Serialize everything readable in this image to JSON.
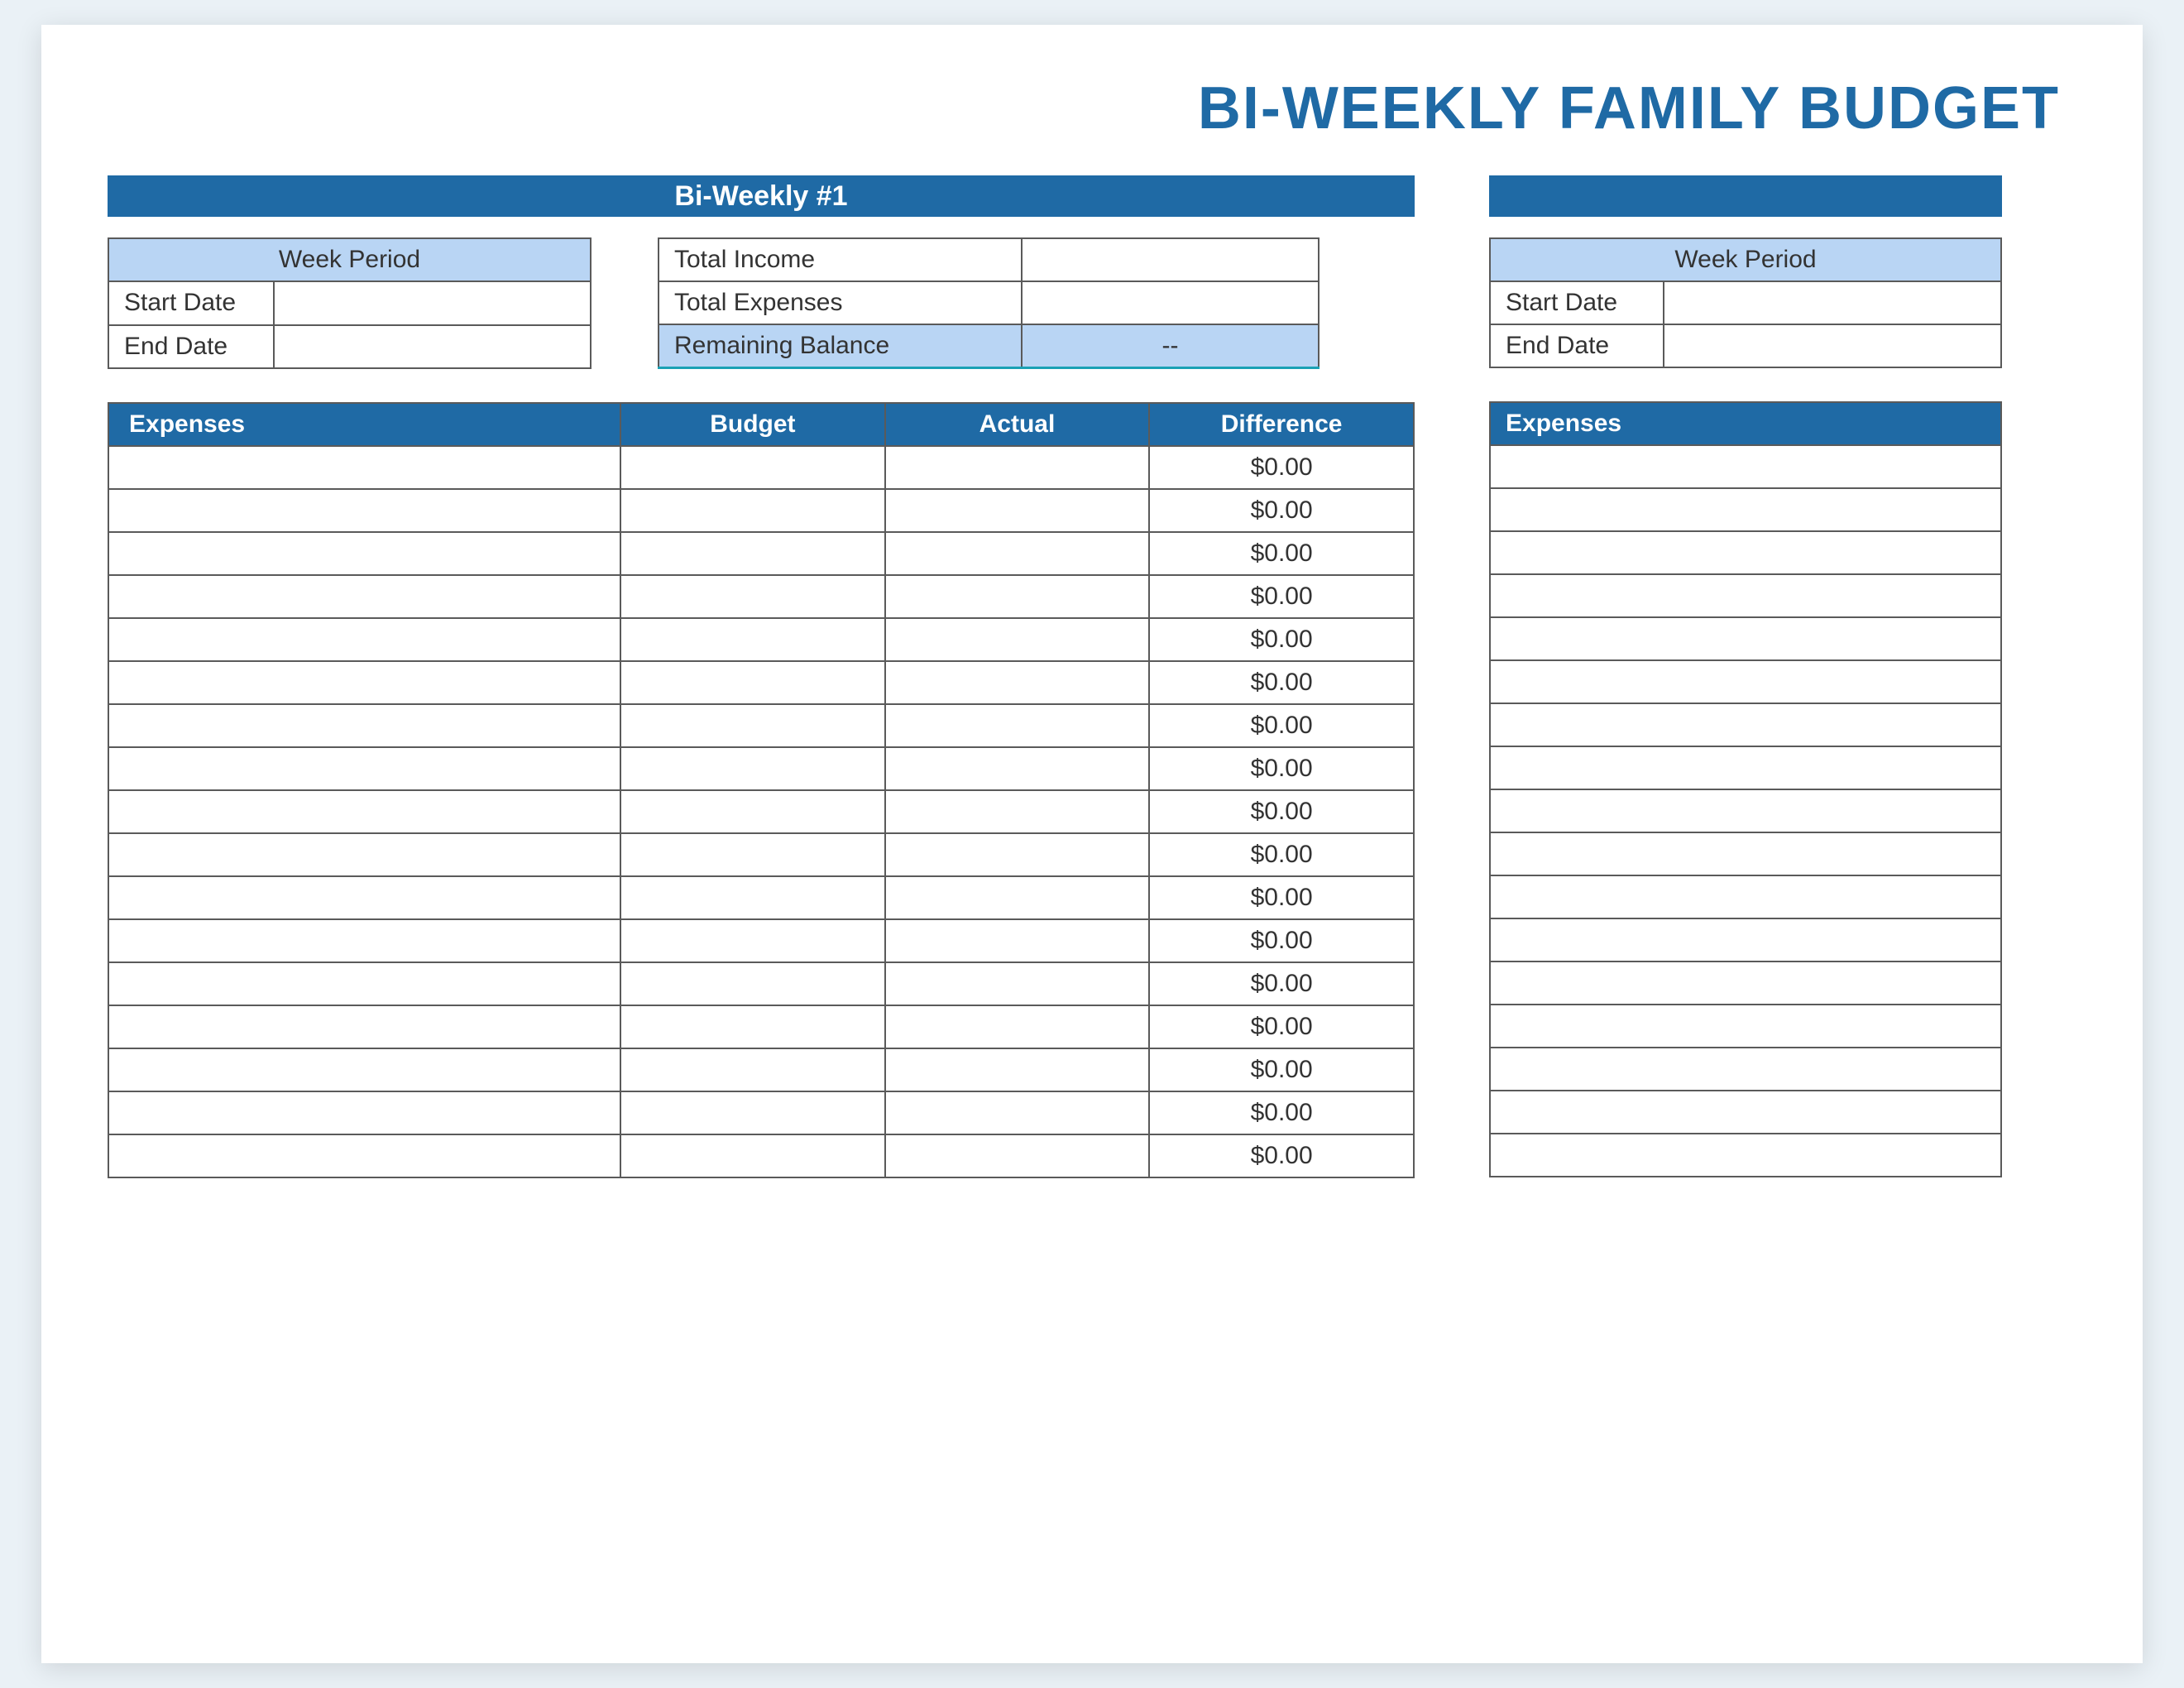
{
  "title": "BI-WEEKLY FAMILY BUDGET",
  "left": {
    "period_bar": "Bi-Weekly #1",
    "week": {
      "header": "Week Period",
      "start_label": "Start Date",
      "start_value": "",
      "end_label": "End Date",
      "end_value": ""
    },
    "totals": {
      "income_label": "Total Income",
      "income_value": "",
      "expenses_label": "Total Expenses",
      "expenses_value": "",
      "remaining_label": "Remaining Balance",
      "remaining_value": "--"
    },
    "expenses": {
      "h_expenses": "Expenses",
      "h_budget": "Budget",
      "h_actual": "Actual",
      "h_diff": "Difference",
      "rows": [
        {
          "name": "",
          "budget": "",
          "actual": "",
          "diff": "$0.00"
        },
        {
          "name": "",
          "budget": "",
          "actual": "",
          "diff": "$0.00"
        },
        {
          "name": "",
          "budget": "",
          "actual": "",
          "diff": "$0.00"
        },
        {
          "name": "",
          "budget": "",
          "actual": "",
          "diff": "$0.00"
        },
        {
          "name": "",
          "budget": "",
          "actual": "",
          "diff": "$0.00"
        },
        {
          "name": "",
          "budget": "",
          "actual": "",
          "diff": "$0.00"
        },
        {
          "name": "",
          "budget": "",
          "actual": "",
          "diff": "$0.00"
        },
        {
          "name": "",
          "budget": "",
          "actual": "",
          "diff": "$0.00"
        },
        {
          "name": "",
          "budget": "",
          "actual": "",
          "diff": "$0.00"
        },
        {
          "name": "",
          "budget": "",
          "actual": "",
          "diff": "$0.00"
        },
        {
          "name": "",
          "budget": "",
          "actual": "",
          "diff": "$0.00"
        },
        {
          "name": "",
          "budget": "",
          "actual": "",
          "diff": "$0.00"
        },
        {
          "name": "",
          "budget": "",
          "actual": "",
          "diff": "$0.00"
        },
        {
          "name": "",
          "budget": "",
          "actual": "",
          "diff": "$0.00"
        },
        {
          "name": "",
          "budget": "",
          "actual": "",
          "diff": "$0.00"
        },
        {
          "name": "",
          "budget": "",
          "actual": "",
          "diff": "$0.00"
        },
        {
          "name": "",
          "budget": "",
          "actual": "",
          "diff": "$0.00"
        }
      ]
    }
  },
  "right": {
    "period_bar": "",
    "week": {
      "header": "Week Period",
      "start_label": "Start Date",
      "start_value": "",
      "end_label": "End Date",
      "end_value": ""
    },
    "expenses": {
      "h_expenses": "Expenses",
      "row_count": 17
    }
  }
}
